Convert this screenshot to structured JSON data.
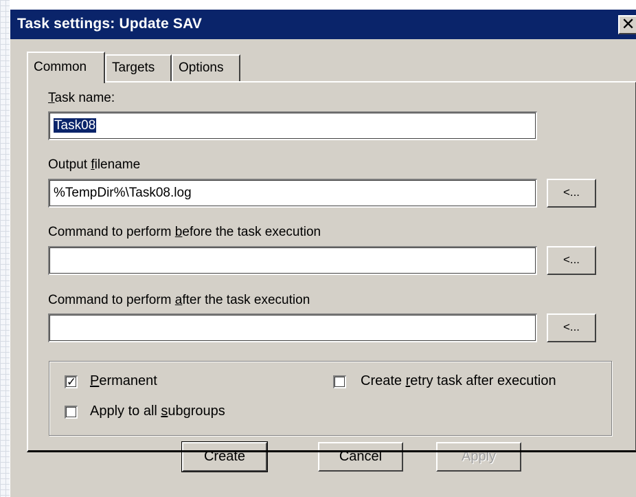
{
  "window": {
    "title": "Task settings: Update SAV",
    "close_glyph": "✕"
  },
  "tabs": [
    {
      "label": "Common",
      "active": true
    },
    {
      "label": "Targets",
      "active": false
    },
    {
      "label": "Options",
      "active": false
    }
  ],
  "fields": {
    "task_name": {
      "label_prefix": "",
      "label_hotkey": "T",
      "label_rest": "ask name:",
      "value": "Task08"
    },
    "output_filename": {
      "label_prefix": "Output ",
      "label_hotkey": "f",
      "label_rest": "ilename",
      "value": "%TempDir%\\Task08.log",
      "browse_label": "<..."
    },
    "command_before": {
      "label_prefix": "Command to perform ",
      "label_hotkey": "b",
      "label_rest": "efore the task execution",
      "value": "",
      "browse_label": "<..."
    },
    "command_after": {
      "label_prefix": "Command to perform ",
      "label_hotkey": "a",
      "label_rest": "fter the task execution",
      "value": "",
      "browse_label": "<..."
    }
  },
  "checkboxes": {
    "permanent": {
      "label_prefix": "",
      "label_hotkey": "P",
      "label_rest": "ermanent",
      "checked": true,
      "mark": "✓"
    },
    "apply_subgroups": {
      "label_prefix": "Apply to all ",
      "label_hotkey": "s",
      "label_rest": "ubgroups",
      "checked": false,
      "mark": ""
    },
    "create_retry": {
      "label_prefix": "Create ",
      "label_hotkey": "r",
      "label_rest": "etry task after execution",
      "checked": false,
      "mark": ""
    }
  },
  "buttons": {
    "create": "Create",
    "cancel": "Cancel",
    "apply": "Apply"
  },
  "colors": {
    "titlebar": "#0a246a",
    "dialog_face": "#d4d0c8",
    "selection": "#0a246a"
  }
}
